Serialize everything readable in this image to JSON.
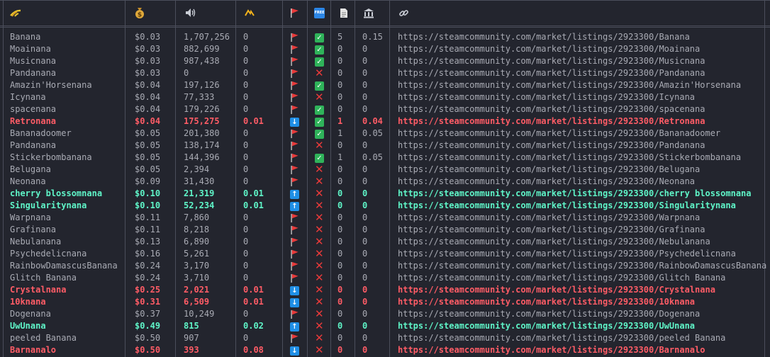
{
  "header": {
    "icons": [
      "banana-bunch-icon",
      "money-bag-icon",
      "speaker-icon",
      "trend-icon",
      "red-flag-icon",
      "free-badge-icon",
      "document-icon",
      "bank-icon",
      "link-icon"
    ],
    "free_badge_text": "FREE"
  },
  "colors": {
    "red": "#ff5c66",
    "green": "#5ff5c8",
    "default": "#a9abb4"
  },
  "rows": [
    {
      "name": "Banana",
      "price": "$0.03",
      "volume": "1,707,256",
      "change": "0",
      "arrow": "flag",
      "free": "check",
      "docs": "5",
      "bank": "0.15",
      "url": "https://steamcommunity.com/market/listings/2923300/Banana",
      "style": "normal"
    },
    {
      "name": "Moainana",
      "price": "$0.03",
      "volume": "882,699",
      "change": "0",
      "arrow": "flag",
      "free": "check",
      "docs": "0",
      "bank": "0",
      "url": "https://steamcommunity.com/market/listings/2923300/Moainana",
      "style": "normal"
    },
    {
      "name": "Musicnana",
      "price": "$0.03",
      "volume": "987,438",
      "change": "0",
      "arrow": "flag",
      "free": "check",
      "docs": "0",
      "bank": "0",
      "url": "https://steamcommunity.com/market/listings/2923300/Musicnana",
      "style": "normal"
    },
    {
      "name": "Pandanana",
      "price": "$0.03",
      "volume": "0",
      "change": "0",
      "arrow": "flag",
      "free": "x",
      "docs": "0",
      "bank": "0",
      "url": "https://steamcommunity.com/market/listings/2923300/Pandanana",
      "style": "normal"
    },
    {
      "name": "Amazin'Horsenana",
      "price": "$0.04",
      "volume": "197,126",
      "change": "0",
      "arrow": "flag",
      "free": "check",
      "docs": "0",
      "bank": "0",
      "url": "https://steamcommunity.com/market/listings/2923300/Amazin'Horsenana",
      "style": "normal"
    },
    {
      "name": "Icynana",
      "price": "$0.04",
      "volume": "77,333",
      "change": "0",
      "arrow": "flag",
      "free": "x",
      "docs": "0",
      "bank": "0",
      "url": "https://steamcommunity.com/market/listings/2923300/Icynana",
      "style": "normal"
    },
    {
      "name": "spacenana",
      "price": "$0.04",
      "volume": "179,226",
      "change": "0",
      "arrow": "flag",
      "free": "check",
      "docs": "0",
      "bank": "0",
      "url": "https://steamcommunity.com/market/listings/2923300/spacenana",
      "style": "normal"
    },
    {
      "name": "Retronana",
      "price": "$0.04",
      "volume": "175,275",
      "change": "0.01",
      "arrow": "down",
      "free": "check",
      "docs": "1",
      "bank": "0.04",
      "url": "https://steamcommunity.com/market/listings/2923300/Retronana",
      "style": "red"
    },
    {
      "name": "Bananadoomer",
      "price": "$0.05",
      "volume": "201,380",
      "change": "0",
      "arrow": "flag",
      "free": "check",
      "docs": "1",
      "bank": "0.05",
      "url": "https://steamcommunity.com/market/listings/2923300/Bananadoomer",
      "style": "normal"
    },
    {
      "name": "Pandanana",
      "price": "$0.05",
      "volume": "138,174",
      "change": "0",
      "arrow": "flag",
      "free": "x",
      "docs": "0",
      "bank": "0",
      "url": "https://steamcommunity.com/market/listings/2923300/Pandanana",
      "style": "normal"
    },
    {
      "name": "Stickerbombanana",
      "price": "$0.05",
      "volume": "144,396",
      "change": "0",
      "arrow": "flag",
      "free": "check",
      "docs": "1",
      "bank": "0.05",
      "url": "https://steamcommunity.com/market/listings/2923300/Stickerbombanana",
      "style": "normal"
    },
    {
      "name": "Beluganа",
      "price": "$0.05",
      "volume": "2,394",
      "change": "0",
      "arrow": "flag",
      "free": "x",
      "docs": "0",
      "bank": "0",
      "url": "https://steamcommunity.com/market/listings/2923300/Belugana",
      "style": "normal"
    },
    {
      "name": "Neonana",
      "price": "$0.09",
      "volume": "31,430",
      "change": "0",
      "arrow": "flag",
      "free": "x",
      "docs": "0",
      "bank": "0",
      "url": "https://steamcommunity.com/market/listings/2923300/Neonana",
      "style": "normal"
    },
    {
      "name": "cherry blossomnana",
      "price": "$0.10",
      "volume": "21,319",
      "change": "0.01",
      "arrow": "up",
      "free": "x",
      "docs": "0",
      "bank": "0",
      "url": "https://steamcommunity.com/market/listings/2923300/cherry blossomnana",
      "style": "green"
    },
    {
      "name": "Singularitynana",
      "price": "$0.10",
      "volume": "52,234",
      "change": "0.01",
      "arrow": "up",
      "free": "x",
      "docs": "0",
      "bank": "0",
      "url": "https://steamcommunity.com/market/listings/2923300/Singularitynana",
      "style": "green"
    },
    {
      "name": "Warpnana",
      "price": "$0.11",
      "volume": "7,860",
      "change": "0",
      "arrow": "flag",
      "free": "x",
      "docs": "0",
      "bank": "0",
      "url": "https://steamcommunity.com/market/listings/2923300/Warpnana",
      "style": "normal"
    },
    {
      "name": "Grafinana",
      "price": "$0.11",
      "volume": "8,218",
      "change": "0",
      "arrow": "flag",
      "free": "x",
      "docs": "0",
      "bank": "0",
      "url": "https://steamcommunity.com/market/listings/2923300/Grafinana",
      "style": "normal"
    },
    {
      "name": "Nebulanana",
      "price": "$0.13",
      "volume": "6,890",
      "change": "0",
      "arrow": "flag",
      "free": "x",
      "docs": "0",
      "bank": "0",
      "url": "https://steamcommunity.com/market/listings/2923300/Nebulanana",
      "style": "normal"
    },
    {
      "name": "Psychedelicnana",
      "price": "$0.16",
      "volume": "5,261",
      "change": "0",
      "arrow": "flag",
      "free": "x",
      "docs": "0",
      "bank": "0",
      "url": "https://steamcommunity.com/market/listings/2923300/Psychedelicnana",
      "style": "normal"
    },
    {
      "name": "RainbowDamascusBanana",
      "price": "$0.24",
      "volume": "3,170",
      "change": "0",
      "arrow": "flag",
      "free": "x",
      "docs": "0",
      "bank": "0",
      "url": "https://steamcommunity.com/market/listings/2923300/RainbowDamascusBanana",
      "style": "normal"
    },
    {
      "name": "Glitch Banana",
      "price": "$0.24",
      "volume": "3,710",
      "change": "0",
      "arrow": "flag",
      "free": "x",
      "docs": "0",
      "bank": "0",
      "url": "https://steamcommunity.com/market/listings/2923300/Glitch Banana",
      "style": "normal"
    },
    {
      "name": "Crystalnana",
      "price": "$0.25",
      "volume": "2,021",
      "change": "0.01",
      "arrow": "down",
      "free": "x",
      "docs": "0",
      "bank": "0",
      "url": "https://steamcommunity.com/market/listings/2923300/Crystalnana",
      "style": "red"
    },
    {
      "name": "10knana",
      "price": "$0.31",
      "volume": "6,509",
      "change": "0.01",
      "arrow": "down",
      "free": "x",
      "docs": "0",
      "bank": "0",
      "url": "https://steamcommunity.com/market/listings/2923300/10knana",
      "style": "red"
    },
    {
      "name": "Dogenana",
      "price": "$0.37",
      "volume": "10,249",
      "change": "0",
      "arrow": "flag",
      "free": "x",
      "docs": "0",
      "bank": "0",
      "url": "https://steamcommunity.com/market/listings/2923300/Dogenana",
      "style": "normal"
    },
    {
      "name": "UwUnana",
      "price": "$0.49",
      "volume": "815",
      "change": "0.02",
      "arrow": "up",
      "free": "x",
      "docs": "0",
      "bank": "0",
      "url": "https://steamcommunity.com/market/listings/2923300/UwUnana",
      "style": "green"
    },
    {
      "name": "peeled Banana",
      "price": "$0.50",
      "volume": "907",
      "change": "0",
      "arrow": "flag",
      "free": "x",
      "docs": "0",
      "bank": "0",
      "url": "https://steamcommunity.com/market/listings/2923300/peeled Banana",
      "style": "normal"
    },
    {
      "name": "Barnanalo",
      "price": "$0.50",
      "volume": "393",
      "change": "0.08",
      "arrow": "down",
      "free": "x",
      "docs": "0",
      "bank": "0",
      "url": "https://steamcommunity.com/market/listings/2923300/Barnanalo",
      "style": "red"
    }
  ]
}
